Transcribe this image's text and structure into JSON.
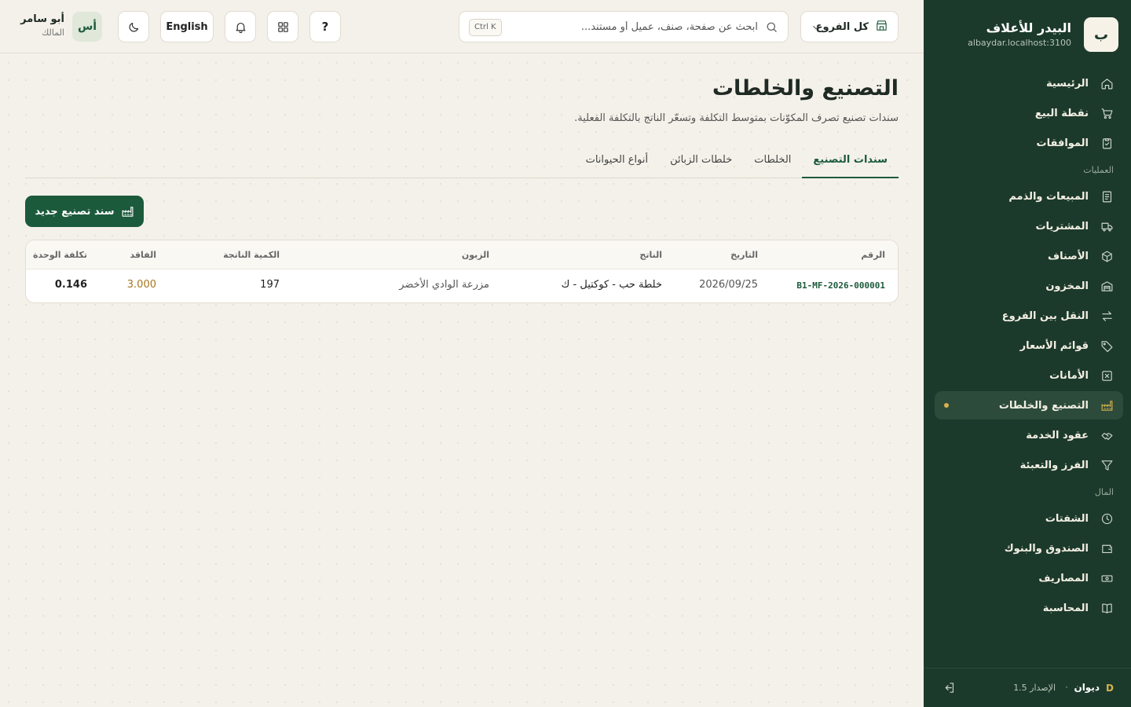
{
  "sidebar": {
    "brand_initial": "ب",
    "brand_name": "البيدر للأعلاف",
    "brand_host": "albaydar.localhost:3100",
    "items_top": [
      {
        "label": "الرئيسية",
        "icon": "home-icon"
      },
      {
        "label": "نقطة البيع",
        "icon": "cart-icon"
      },
      {
        "label": "الموافقات",
        "icon": "clipboard-check-icon"
      }
    ],
    "section_ops": "العمليات",
    "items_ops": [
      {
        "label": "المبيعات والذمم",
        "icon": "receipt-icon"
      },
      {
        "label": "المشتريات",
        "icon": "truck-icon"
      },
      {
        "label": "الأصناف",
        "icon": "box-icon"
      },
      {
        "label": "المخزون",
        "icon": "warehouse-icon"
      },
      {
        "label": "النقل بين الفروع",
        "icon": "transfer-icon"
      },
      {
        "label": "قوائم الأسعار",
        "icon": "tag-icon"
      },
      {
        "label": "الأمانات",
        "icon": "x-box-icon"
      },
      {
        "label": "التصنيع والخلطات",
        "icon": "factory-icon"
      },
      {
        "label": "عقود الخدمة",
        "icon": "handshake-icon"
      },
      {
        "label": "الفرز والتعبئة",
        "icon": "filter-icon"
      }
    ],
    "section_money": "المال",
    "items_money": [
      {
        "label": "الشفتات",
        "icon": "clock-icon"
      },
      {
        "label": "الصندوق والبنوك",
        "icon": "wallet-icon"
      },
      {
        "label": "المصاريف",
        "icon": "banknote-icon"
      },
      {
        "label": "المحاسبة",
        "icon": "book-icon"
      }
    ],
    "footer_name": "ديوان",
    "footer_sep": "·",
    "footer_version": "الإصدار 1.5"
  },
  "topbar": {
    "branch_label": "كل الفروع",
    "search_placeholder": "ابحث عن صفحة، صنف، عميل أو مستند...",
    "search_shortcut": "Ctrl K",
    "help_label": "?",
    "lang_label": "English",
    "user_initials": "أس",
    "user_name": "أبو سامر",
    "user_role": "المالك"
  },
  "page": {
    "title": "التصنيع والخلطات",
    "subtitle": "سندات تصنيع تصرف المكوّنات بمتوسط التكلفة وتسعّر الناتج بالتكلفة الفعلية.",
    "tabs": [
      "سندات التصنيع",
      "الخلطات",
      "خلطات الزبائن",
      "أنواع الحيوانات"
    ],
    "new_button": "سند تصنيع جديد"
  },
  "table": {
    "headers": {
      "num": "الرقم",
      "date": "التاريخ",
      "output": "الناتج",
      "customer": "الزبون",
      "qty": "الكمية الناتجة",
      "loss": "الفاقد",
      "unit_cost": "تكلفة الوحدة"
    },
    "rows": [
      {
        "num": "B1-MF-2026-000001",
        "date": "2026/09/25",
        "output": "خلطة حب - كوكتيل - ك",
        "customer": "مزرعة الوادي الأخضر",
        "qty": "197",
        "loss": "3.000",
        "unit_cost": "0.146"
      }
    ]
  },
  "colors": {
    "sidebar_bg": "#1c3a2b",
    "accent": "#1c5a3c",
    "gold": "#d8b24c",
    "page_bg": "#f4f1ea"
  }
}
